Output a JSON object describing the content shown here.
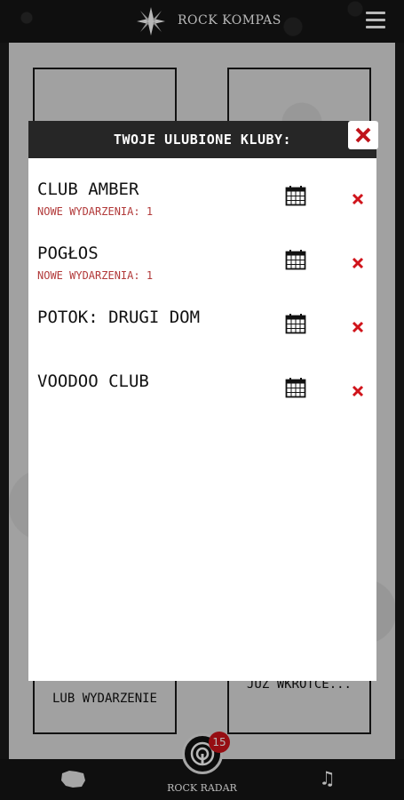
{
  "header": {
    "title": "ROCK KOMPAS",
    "logo_icon": "compass-star-icon",
    "menu_icon": "hamburger-menu-icon"
  },
  "background": {
    "tiles": [
      {
        "label": ""
      },
      {
        "label": ""
      },
      {
        "label": "LUB WYDARZENIE"
      },
      {
        "label": "JUŻ WKRÓTCE..."
      }
    ]
  },
  "footer": {
    "radar_label": "ROCK RADAR",
    "radar_badge": "15",
    "map_icon": "poland-map-icon",
    "music_icon": "music-note-icon"
  },
  "modal": {
    "title": "TWOJE ULUBIONE KLUBY:",
    "close_icon": "close-icon",
    "clubs": [
      {
        "name": "CLUB AMBER",
        "events": "NOWE WYDARZENIA: 1"
      },
      {
        "name": "POGŁOS",
        "events": "NOWE WYDARZENIA: 1"
      },
      {
        "name": "POTOK: DRUGI DOM",
        "events": ""
      },
      {
        "name": "VOODOO CLUB",
        "events": ""
      }
    ]
  },
  "colors": {
    "dark": "#1b1b1b",
    "accent_red": "#d0141b",
    "events_red": "#b23a3a"
  }
}
